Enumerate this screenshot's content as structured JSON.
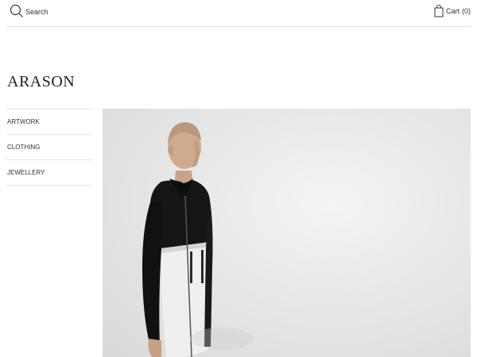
{
  "header": {
    "search": {
      "placeholder": "Search",
      "icon": "search-icon"
    },
    "cart": {
      "label": "Cart",
      "count": "(0)",
      "icon": "shopping-bag-icon"
    }
  },
  "brand": {
    "name": "ARASON"
  },
  "sidebar": {
    "items": [
      {
        "label": "ARTWORK"
      },
      {
        "label": "CLOTHING"
      },
      {
        "label": "JEWELLERY"
      }
    ]
  },
  "colors": {
    "background": "#ffffff",
    "text": "#222222",
    "divider": "#e6e6e6",
    "hero_backdrop": "#e8e8e8"
  }
}
